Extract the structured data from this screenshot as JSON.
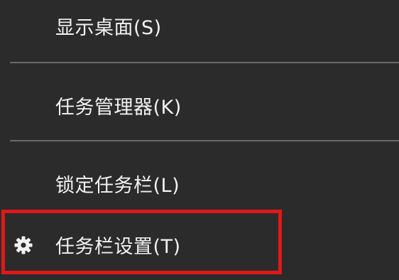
{
  "menu": {
    "items": [
      {
        "label": "显示桌面(S)"
      },
      {
        "label": "任务管理器(K)"
      },
      {
        "label": "锁定任务栏(L)"
      },
      {
        "label": "任务栏设置(T)",
        "icon": "gear-icon"
      }
    ]
  },
  "colors": {
    "background": "#2b2b2b",
    "text": "#f2f2f2",
    "separator": "#6a6a6a",
    "highlight_border": "#e01818"
  }
}
